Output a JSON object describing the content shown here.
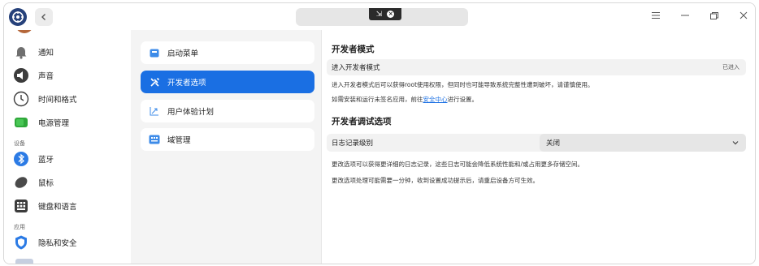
{
  "titlebar": {
    "capture_icon": "⇲",
    "capture_close": "×"
  },
  "sidebar": {
    "items": [
      {
        "label": "通知",
        "icon": "bell-icon"
      },
      {
        "label": "声音",
        "icon": "speaker-icon"
      },
      {
        "label": "时间和格式",
        "icon": "clock-icon"
      },
      {
        "label": "电源管理",
        "icon": "battery-icon"
      },
      {
        "label": "蓝牙",
        "icon": "bluetooth-icon"
      },
      {
        "label": "鼠标",
        "icon": "mouse-icon"
      },
      {
        "label": "键盘和语言",
        "icon": "keyboard-icon"
      },
      {
        "label": "隐私和安全",
        "icon": "shield-icon"
      }
    ],
    "sections": {
      "devices": "设备",
      "apps": "应用"
    }
  },
  "midpane": {
    "items": [
      {
        "label": "启动菜单",
        "icon": "boot-menu-icon",
        "active": false
      },
      {
        "label": "开发者选项",
        "icon": "tools-icon",
        "active": true
      },
      {
        "label": "用户体验计划",
        "icon": "chart-icon",
        "active": false
      },
      {
        "label": "域管理",
        "icon": "domain-icon",
        "active": false
      }
    ]
  },
  "content": {
    "developer_mode": {
      "title": "开发者模式",
      "row_label": "进入开发者模式",
      "row_value": "已进入",
      "desc1": "进入开发者模式后可以获得root使用权限，但同时也可能导致系统完整性遭到破坏，请谨慎使用。",
      "desc2_prefix": "如需安装和运行未签名应用，前往",
      "desc2_link": "安全中心",
      "desc2_suffix": "进行设置。"
    },
    "debug": {
      "title": "开发者调试选项",
      "row_label": "日志记录级别",
      "select_value": "关闭",
      "desc1": "更改选项可以获得更详细的日志记录，这些日志可能会降低系统性能和/或占用更多存储空间。",
      "desc2": "更改选项处理可能需要一分钟，收到设置成功提示后，请重启设备方可生效。"
    }
  },
  "colors": {
    "accent": "#1a6fe3",
    "sidebar_bg": "#ffffff",
    "midpane_bg": "#f4f4f4"
  }
}
